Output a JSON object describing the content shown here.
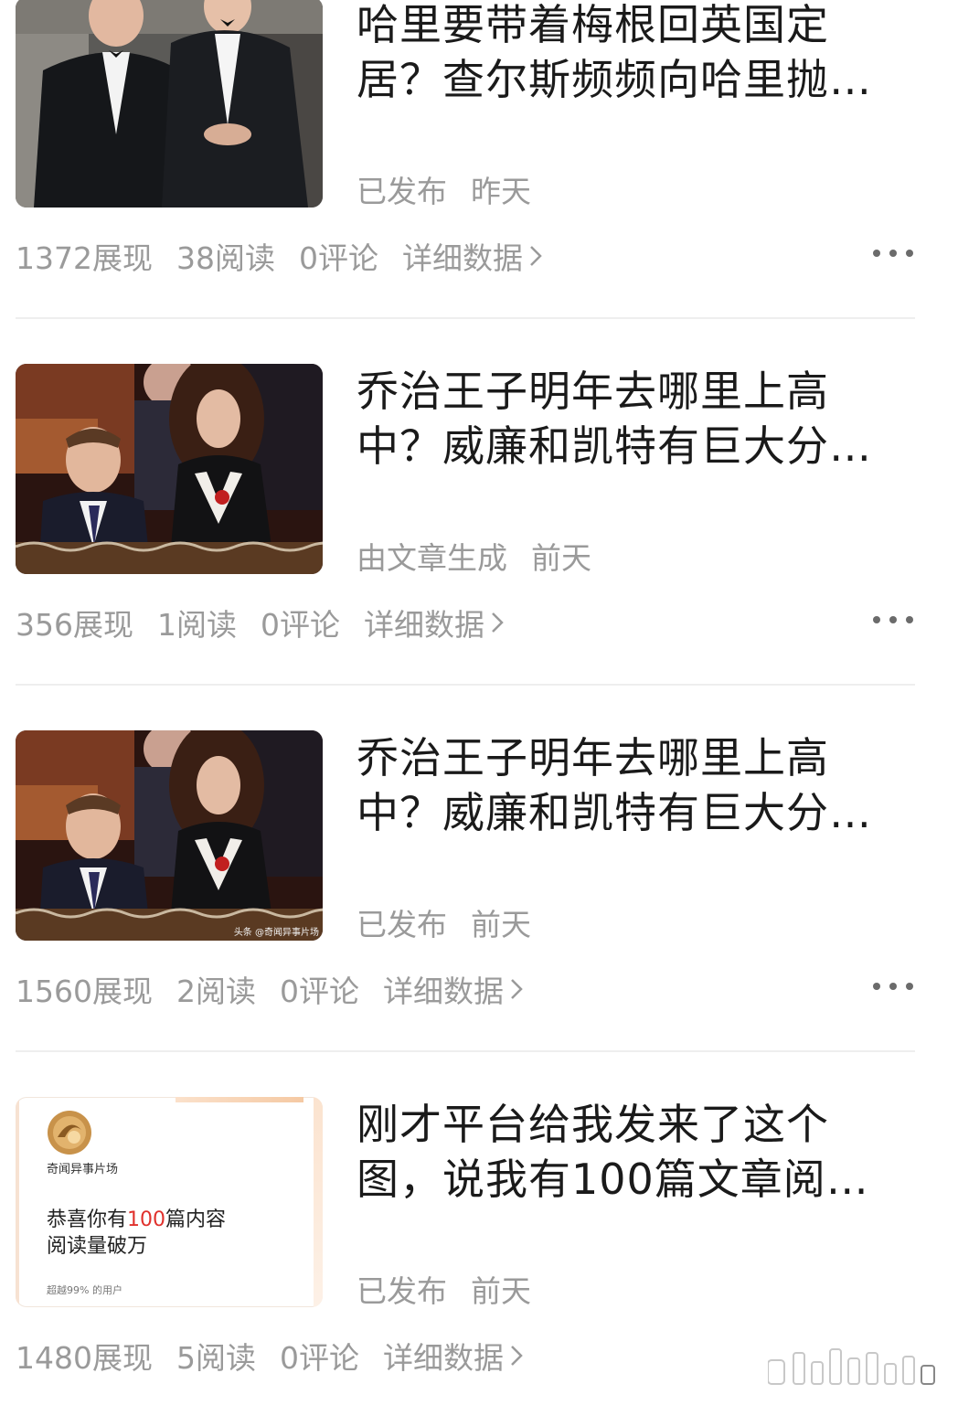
{
  "articles": [
    {
      "title_line1": "哈里要带着梅根回英国定",
      "title_line2": "居？查尔斯频频向哈里抛…",
      "status": "已发布",
      "time": "昨天",
      "impressions": "1372展现",
      "reads": "38阅读",
      "comments": "0评论",
      "detail": "详细数据"
    },
    {
      "title_line1": "乔治王子明年去哪里上高",
      "title_line2": "中？威廉和凯特有巨大分…",
      "status": "由文章生成",
      "time": "前天",
      "impressions": "356展现",
      "reads": "1阅读",
      "comments": "0评论",
      "detail": "详细数据"
    },
    {
      "title_line1": "乔治王子明年去哪里上高",
      "title_line2": "中？威廉和凯特有巨大分…",
      "status": "已发布",
      "time": "前天",
      "impressions": "1560展现",
      "reads": "2阅读",
      "comments": "0评论",
      "detail": "详细数据",
      "thumb_watermark": "头条 @奇闻异事片场"
    },
    {
      "title_line1": "刚才平台给我发来了这个",
      "title_line2": "图，说我有100篇文章阅…",
      "status": "已发布",
      "time": "前天",
      "impressions": "1480展现",
      "reads": "5阅读",
      "comments": "0评论",
      "detail": "详细数据",
      "card": {
        "brand": "奇闻异事片场",
        "line1_pre": "恭喜你有",
        "line1_num": "100",
        "line1_post": "篇内容",
        "line2": "阅读量破万",
        "small": "超越99% 的用户"
      }
    }
  ],
  "colors": {
    "text": "#1a1a1a",
    "meta": "#9a9a9a",
    "divider": "#eeeeee",
    "highlight": "#e0312c"
  }
}
